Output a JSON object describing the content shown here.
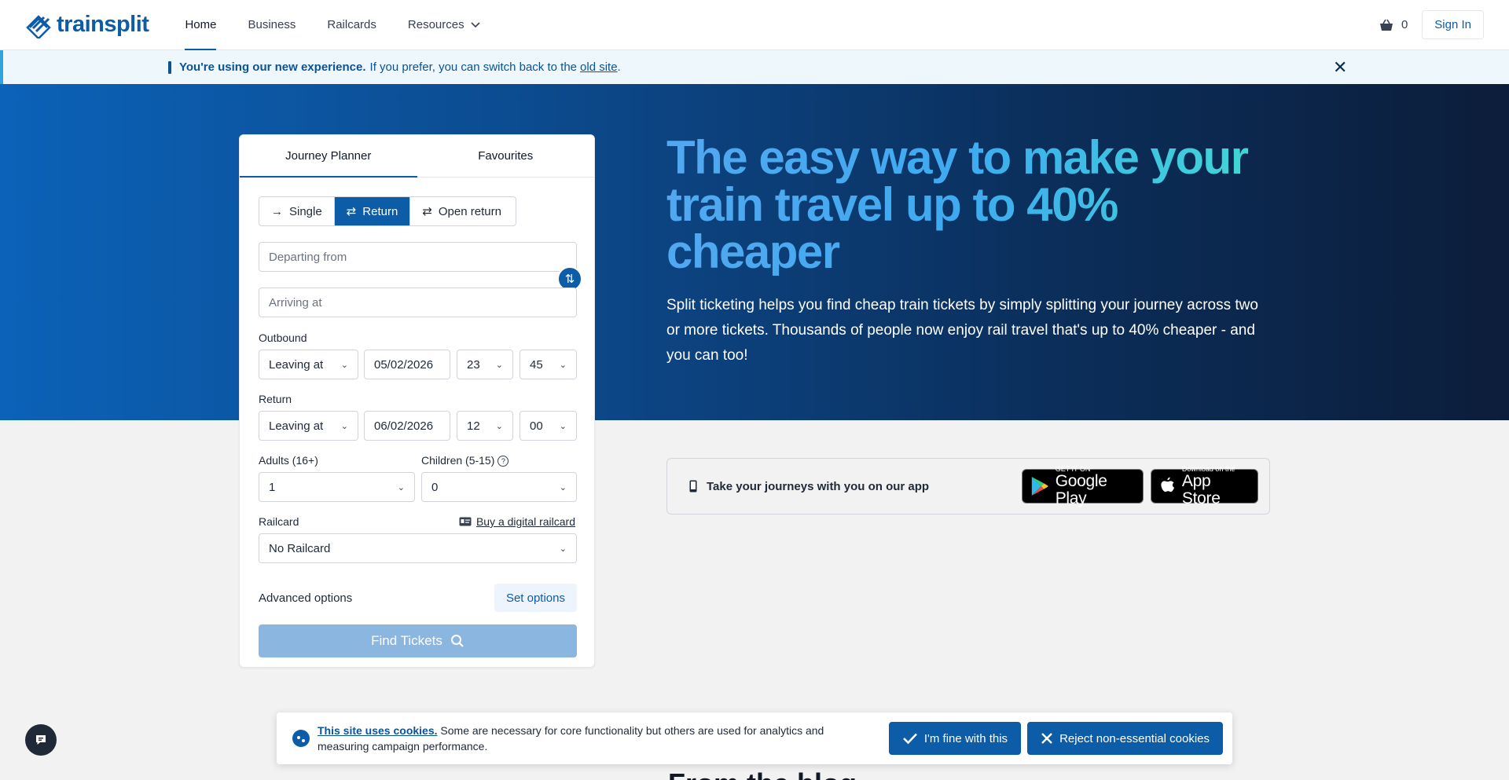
{
  "header": {
    "logo_text": "trainsplit",
    "nav": [
      {
        "label": "Home"
      },
      {
        "label": "Business"
      },
      {
        "label": "Railcards"
      },
      {
        "label": "Resources"
      }
    ],
    "basket_count": "0",
    "signin_label": "Sign In"
  },
  "banner": {
    "strong": "You're using our new experience.",
    "text": "If you prefer, you can switch back to the",
    "link": "old site",
    "trail": "."
  },
  "hero": {
    "title": "The easy way to make your train travel up to 40% cheaper",
    "subtitle": "Split ticketing helps you find cheap train tickets by simply splitting your journey across two or more tickets. Thousands of people now enjoy rail travel that's up to 40% cheaper - and you can too!"
  },
  "planner": {
    "tabs": [
      "Journey Planner",
      "Favourites"
    ],
    "trip_types": [
      "Single",
      "Return",
      "Open return"
    ],
    "from_placeholder": "Departing from",
    "to_placeholder": "Arriving at",
    "outbound": {
      "label": "Outbound",
      "mode": "Leaving at",
      "date": "05/02/2026",
      "hour": "23",
      "minute": "45"
    },
    "return": {
      "label": "Return",
      "mode": "Leaving at",
      "date": "06/02/2026",
      "hour": "12",
      "minute": "00"
    },
    "adults_label": "Adults (16+)",
    "adults_value": "1",
    "children_label": "Children (5-15)",
    "children_value": "0",
    "railcard_label": "Railcard",
    "buy_railcard": "Buy a digital railcard",
    "railcard_value": "No Railcard",
    "advanced_label": "Advanced options",
    "set_options": "Set options",
    "find_tickets": "Find Tickets"
  },
  "app_promo": {
    "text": "Take your journeys with you on our app",
    "google_small": "GET IT ON",
    "google_big": "Google Play",
    "apple_small": "Download on the",
    "apple_big": "App Store"
  },
  "blog_heading": "From the blog",
  "cookies": {
    "strong": "This site uses cookies.",
    "text": "Some are necessary for core functionality but others are used for analytics and measuring campaign performance.",
    "accept": "I'm fine with this",
    "reject": "Reject non-essential cookies"
  },
  "colors": {
    "brand": "#0d5ca8",
    "banner_bg": "#eef7fc",
    "page_bg": "#f2f2f2"
  }
}
